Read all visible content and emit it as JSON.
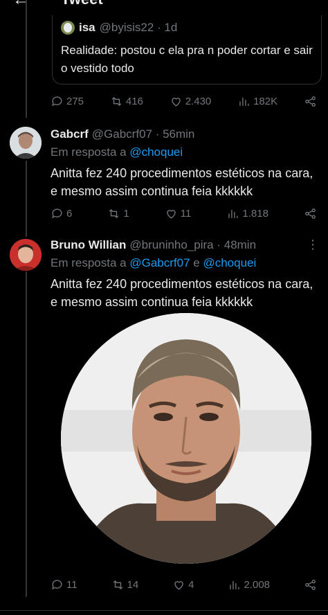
{
  "header": {
    "title": "Tweet"
  },
  "quote": {
    "name": "isa",
    "handle_time": "@byisis22 · 1d",
    "text": "Realidade: postou c ela pra n poder cortar e sair o vestido todo"
  },
  "quote_actions": {
    "replies": "275",
    "retweets": "416",
    "likes": "2.430",
    "views": "182K"
  },
  "tweet1": {
    "name": "Gabcrf",
    "handle_time": "@Gabcrf07 · 56min",
    "reply_prefix": "Em resposta a",
    "reply_mention": "@choquei",
    "text": "Anitta fez 240 procedimentos estéticos na cara, e mesmo assim continua feia kkkkkk",
    "actions": {
      "replies": "6",
      "retweets": "1",
      "likes": "11",
      "views": "1.818"
    }
  },
  "tweet2": {
    "name": "Bruno Willian",
    "handle_time": "@bruninho_pira · 48min",
    "reply_prefix": "Em resposta a",
    "reply_mention1": "@Gabcrf07",
    "reply_and": "e",
    "reply_mention2": "@choquei",
    "text": "Anitta fez 240 procedimentos estéticos na cara, e mesmo assim continua feia kkkkkk",
    "actions": {
      "replies": "11",
      "retweets": "14",
      "likes": "4",
      "views": "2.008"
    }
  },
  "icons": [
    "back-arrow-icon",
    "reply-icon",
    "retweet-icon",
    "like-icon",
    "views-icon",
    "share-icon",
    "more-icon"
  ],
  "colors": {
    "background": "#000000",
    "text": "#e7e9ea",
    "secondary": "#71767b",
    "link": "#1d9bf0",
    "border": "#2f3336"
  }
}
